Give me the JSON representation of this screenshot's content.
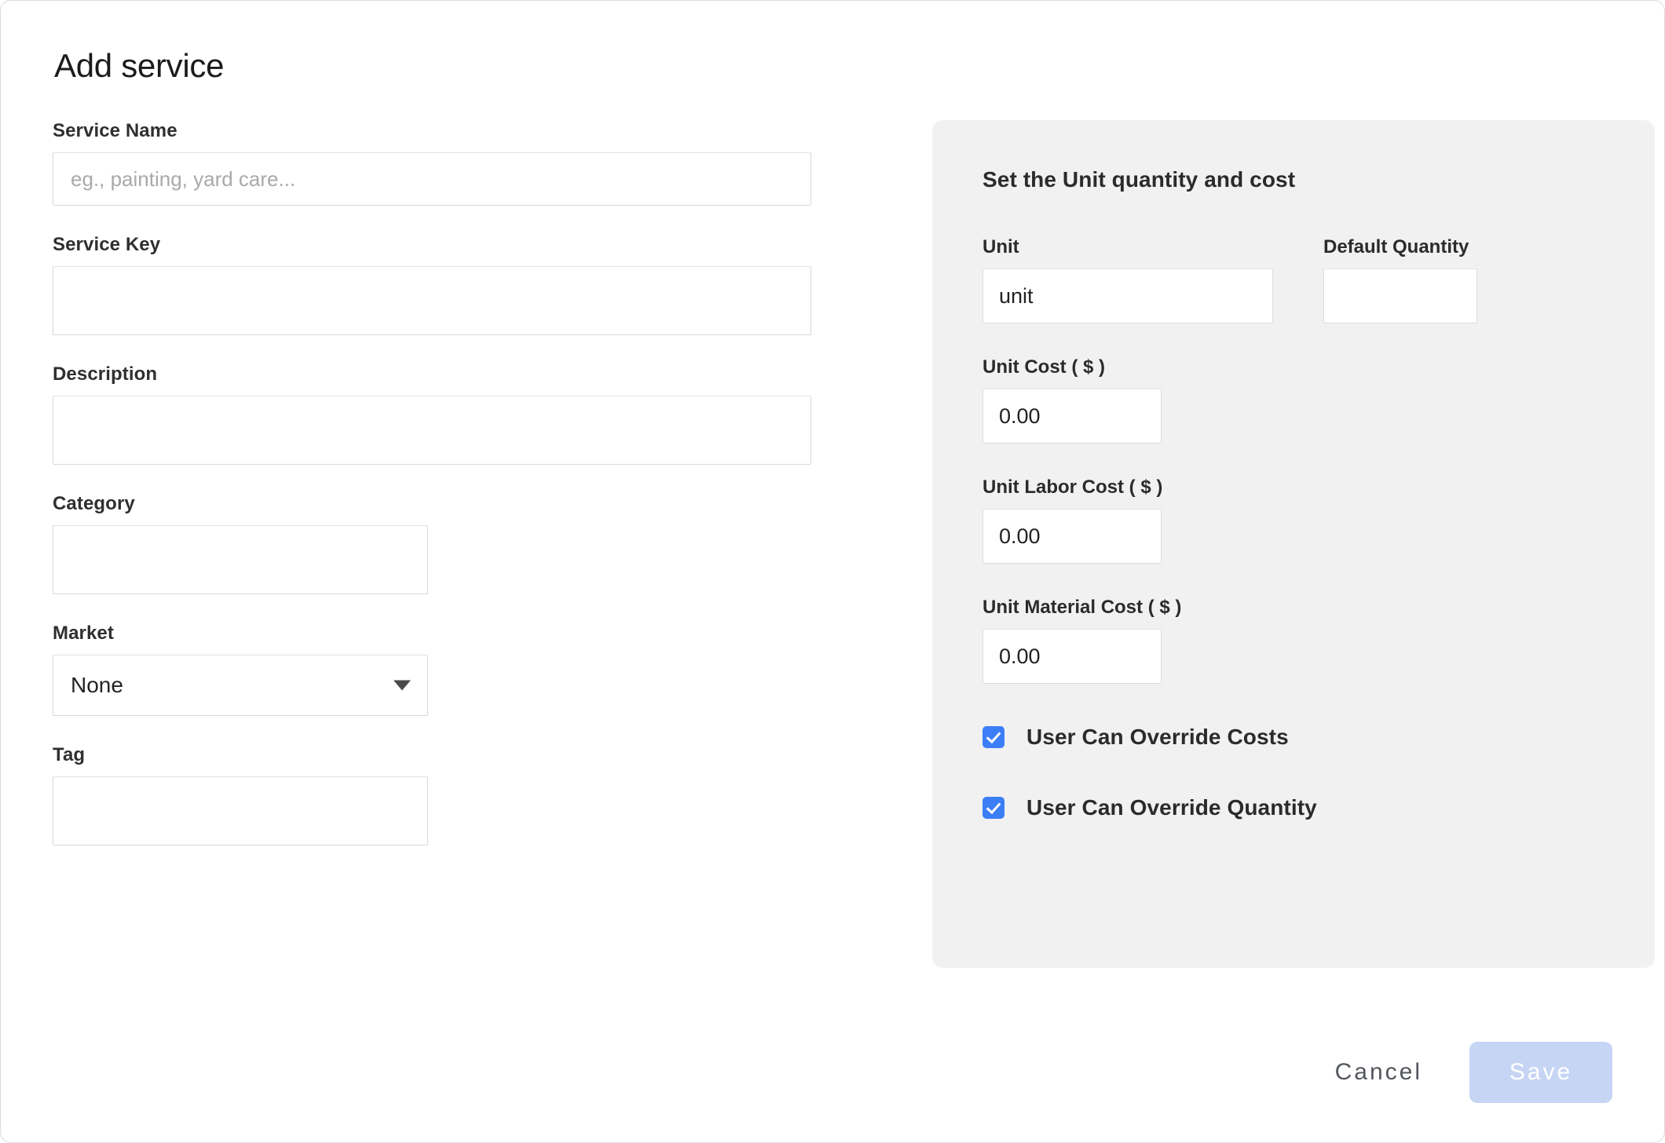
{
  "dialog": {
    "title": "Add service"
  },
  "form": {
    "service_name": {
      "label": "Service Name",
      "placeholder": "eg., painting, yard care...",
      "value": ""
    },
    "service_key": {
      "label": "Service Key",
      "placeholder": "",
      "value": ""
    },
    "description": {
      "label": "Description",
      "placeholder": "",
      "value": ""
    },
    "category": {
      "label": "Category",
      "placeholder": "",
      "value": ""
    },
    "market": {
      "label": "Market",
      "selected": "None",
      "caret_icon": "chevron-down-icon"
    },
    "tag": {
      "label": "Tag",
      "placeholder": "",
      "value": ""
    }
  },
  "unit_panel": {
    "heading": "Set the Unit quantity and cost",
    "unit": {
      "label": "Unit",
      "value": "unit"
    },
    "default_quantity": {
      "label": "Default Quantity",
      "value": ""
    },
    "unit_cost": {
      "label": "Unit Cost ( $ )",
      "value": "0.00"
    },
    "unit_labor_cost": {
      "label": "Unit Labor Cost ( $ )",
      "value": "0.00"
    },
    "unit_material_cost": {
      "label": "Unit Material Cost ( $ )",
      "value": "0.00"
    },
    "checkboxes": [
      {
        "label": "User Can Override Costs",
        "checked": true
      },
      {
        "label": "User Can Override Quantity",
        "checked": true
      }
    ]
  },
  "footer": {
    "cancel_label": "Cancel",
    "save_label": "Save"
  },
  "colors": {
    "panel_background": "#f1f1f1",
    "checkbox_accent": "#3b7ef6",
    "save_button_background": "#c6d5f4",
    "save_button_text": "#ffffff",
    "input_border": "#d8d8d8",
    "text_primary": "#2b2b2b",
    "placeholder_text": "#a9a9a9"
  }
}
